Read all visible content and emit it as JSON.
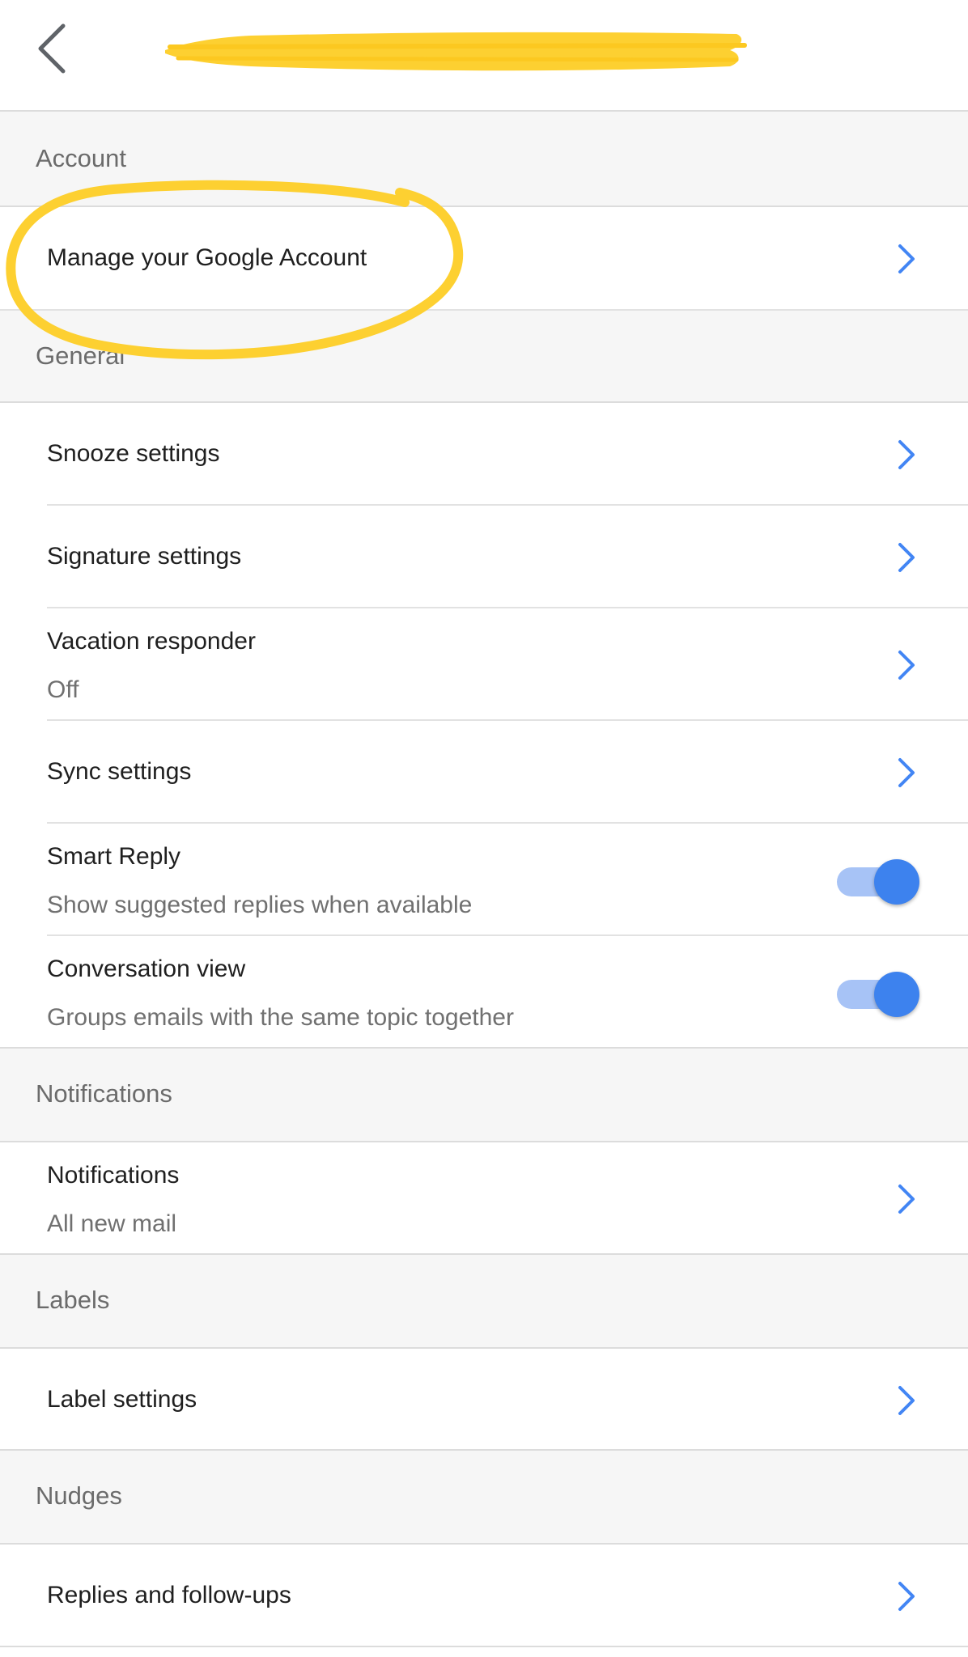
{
  "app": {
    "accent_color": "#4285f4",
    "highlight_color": "#fdd031"
  },
  "topbar": {
    "back_icon": "chevron-left-icon"
  },
  "sections": {
    "account": {
      "header": "Account"
    },
    "general": {
      "header": "General"
    },
    "notifications": {
      "header": "Notifications"
    },
    "labels": {
      "header": "Labels"
    },
    "nudges": {
      "header": "Nudges"
    }
  },
  "items": {
    "manage_account": {
      "title": "Manage your Google Account"
    },
    "snooze": {
      "title": "Snooze settings"
    },
    "signature": {
      "title": "Signature settings"
    },
    "vacation": {
      "title": "Vacation responder",
      "subtitle": "Off"
    },
    "sync": {
      "title": "Sync settings"
    },
    "smart_reply": {
      "title": "Smart Reply",
      "subtitle": "Show suggested replies when available",
      "enabled": true
    },
    "conversation_view": {
      "title": "Conversation view",
      "subtitle": "Groups emails with the same topic together",
      "enabled": true
    },
    "notifications": {
      "title": "Notifications",
      "subtitle": "All new mail"
    },
    "label_settings": {
      "title": "Label settings"
    },
    "replies_followups": {
      "title": "Replies and follow-ups"
    }
  }
}
